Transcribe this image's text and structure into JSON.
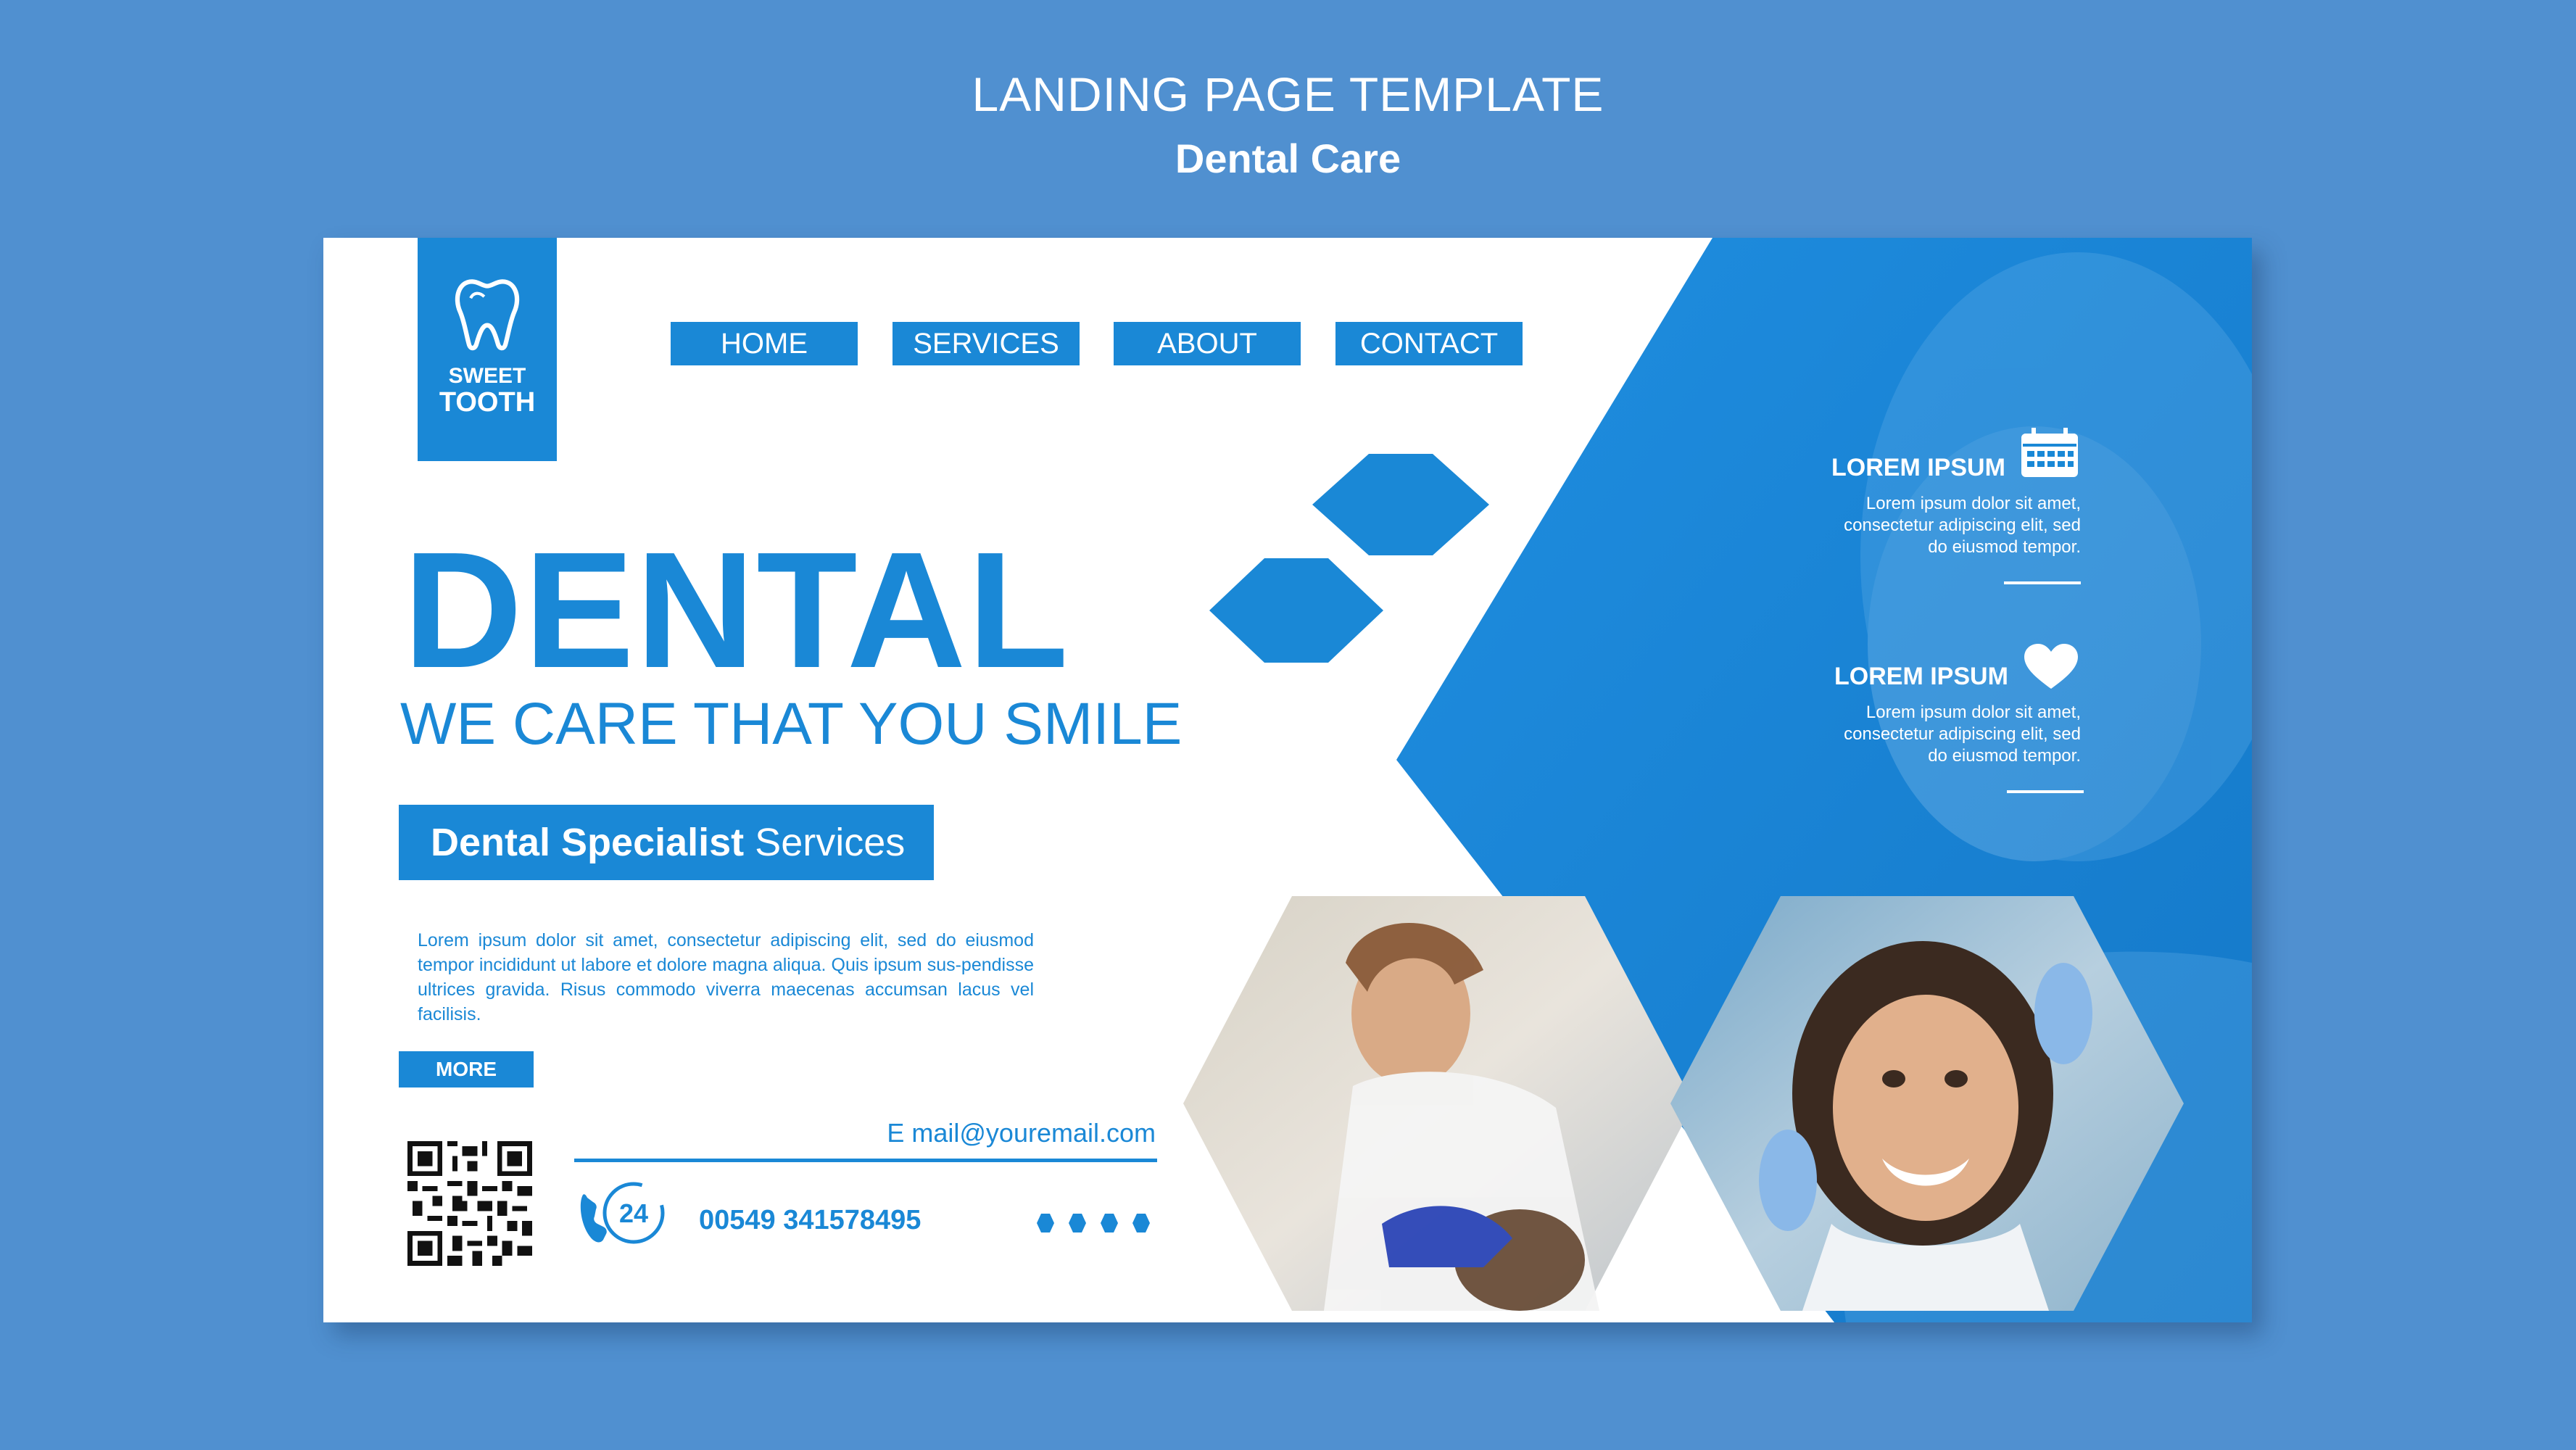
{
  "header": {
    "title": "LANDING PAGE TEMPLATE",
    "subtitle": "Dental Care"
  },
  "logo": {
    "line1": "SWEET",
    "line2": "TOOTH",
    "icon": "tooth-icon"
  },
  "nav": {
    "items": [
      {
        "label": "HOME"
      },
      {
        "label": "SERVICES"
      },
      {
        "label": "ABOUT"
      },
      {
        "label": "CONTACT"
      }
    ]
  },
  "hero": {
    "headline": "DENTAL",
    "tagline": "WE CARE THAT YOU SMILE",
    "specialist_bold": "Dental Specialist",
    "specialist_rest": " Services",
    "body": "Lorem ipsum dolor sit amet, consectetur adipiscing elit, sed do eiusmod tempor incididunt ut labore et dolore magna aliqua. Quis ipsum sus-pendisse ultrices gravida. Risus commodo viverra maecenas accumsan lacus vel facilisis.",
    "more_label": "MORE"
  },
  "contact": {
    "email": "E mail@youremail.com",
    "phone": "00549 341578495",
    "hours_badge": "24",
    "icons": [
      "qr-code-icon",
      "phone-24-icon"
    ]
  },
  "info": [
    {
      "title": "LOREM IPSUM",
      "icon": "calendar-icon",
      "text": "Lorem ipsum dolor sit amet, consectetur adipiscing elit, sed do eiusmod tempor."
    },
    {
      "title": "LOREM IPSUM",
      "icon": "heart-icon",
      "text": "Lorem ipsum dolor sit amet, consectetur adipiscing elit, sed do eiusmod tempor."
    }
  ],
  "colors": {
    "page_bg": "#5090d0",
    "brand_blue": "#1a88d6",
    "white": "#ffffff"
  }
}
